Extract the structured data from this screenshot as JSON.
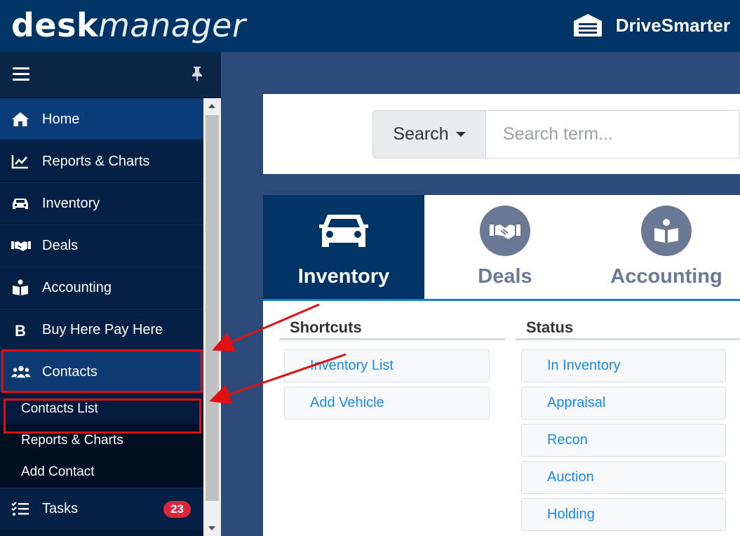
{
  "header": {
    "logo_bold": "desk",
    "logo_italic": "manager",
    "brand_name": "DriveSmarter"
  },
  "sidebar": {
    "items": [
      {
        "label": "Home",
        "icon": "home-icon"
      },
      {
        "label": "Reports & Charts",
        "icon": "chart-line-icon"
      },
      {
        "label": "Inventory",
        "icon": "car-icon"
      },
      {
        "label": "Deals",
        "icon": "handshake-icon"
      },
      {
        "label": "Accounting",
        "icon": "book-reader-icon"
      },
      {
        "label": "Buy Here Pay Here",
        "icon": "bold-b-icon"
      },
      {
        "label": "Contacts",
        "icon": "users-icon"
      }
    ],
    "contacts_sub": [
      "Contacts List",
      "Reports & Charts",
      "Add Contact"
    ],
    "tasks": {
      "label": "Tasks",
      "badge": "23",
      "icon": "tasks-icon"
    }
  },
  "search": {
    "dropdown_label": "Search",
    "placeholder": "Search term..."
  },
  "tabs": [
    {
      "label": "Inventory",
      "icon": "car-icon"
    },
    {
      "label": "Deals",
      "icon": "handshake-icon"
    },
    {
      "label": "Accounting",
      "icon": "book-reader-icon"
    }
  ],
  "shortcuts": {
    "heading": "Shortcuts",
    "items": [
      "Inventory List",
      "Add Vehicle"
    ]
  },
  "status": {
    "heading": "Status",
    "items": [
      "In Inventory",
      "Appraisal",
      "Recon",
      "Auction",
      "Holding"
    ]
  },
  "colors": {
    "header_bg": "#003366",
    "accent_blue": "#1a8ae6",
    "highlight_red": "#e01010",
    "badge_red": "#d9283b"
  }
}
